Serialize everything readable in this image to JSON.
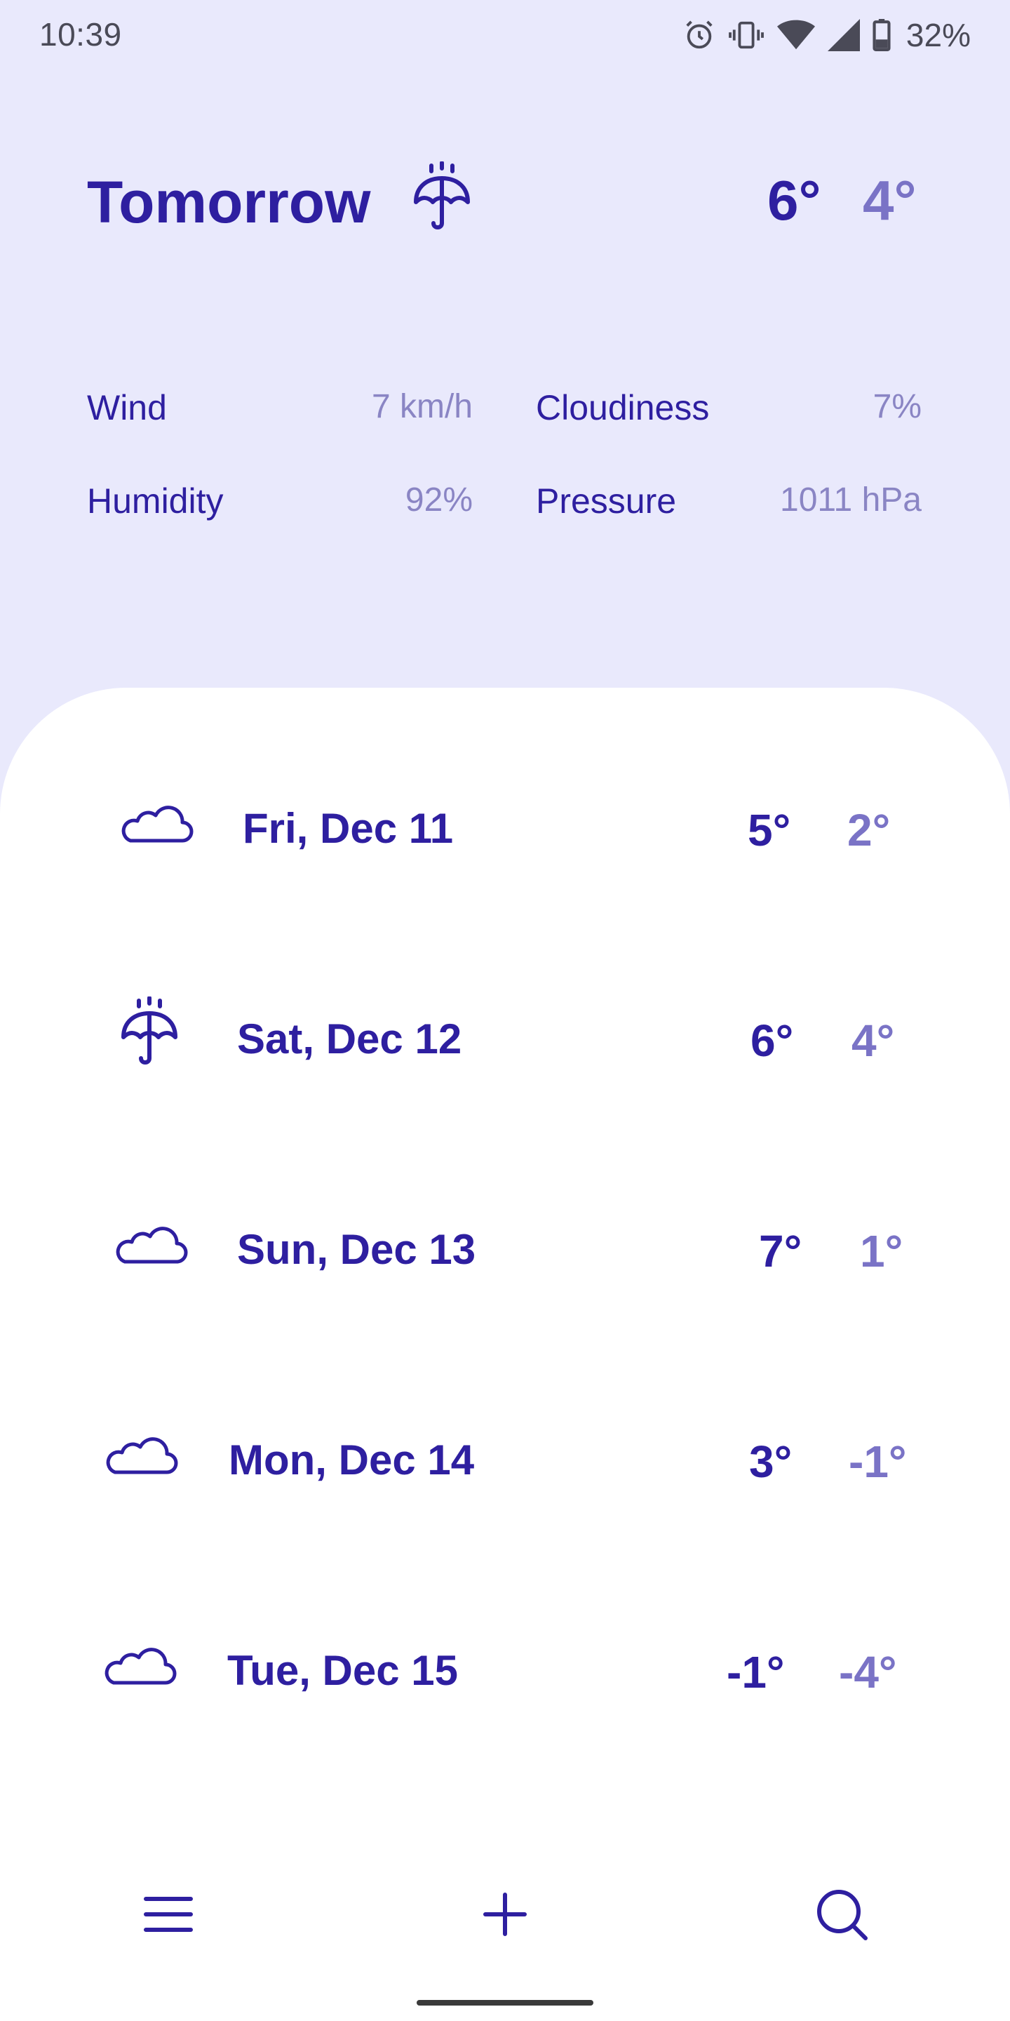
{
  "status_bar": {
    "time": "10:39",
    "battery_percent": "32%",
    "icons": [
      "alarm-icon",
      "vibrate-icon",
      "wifi-icon",
      "signal-icon",
      "battery-icon"
    ]
  },
  "header": {
    "title": "Tomorrow",
    "condition_icon": "umbrella-icon",
    "high": "6°",
    "low": "4°"
  },
  "details": {
    "wind_label": "Wind",
    "wind_value": "7 km/h",
    "cloudiness_label": "Cloudiness",
    "cloudiness_value": "7%",
    "humidity_label": "Humidity",
    "humidity_value": "92%",
    "pressure_label": "Pressure",
    "pressure_value": "1011 hPa"
  },
  "forecast": [
    {
      "icon": "cloud-icon",
      "date": "Fri, Dec 11",
      "high": "5°",
      "low": "2°"
    },
    {
      "icon": "umbrella-icon",
      "date": "Sat, Dec 12",
      "high": "6°",
      "low": "4°"
    },
    {
      "icon": "cloud-icon",
      "date": "Sun, Dec 13",
      "high": "7°",
      "low": "1°"
    },
    {
      "icon": "cloud-icon",
      "date": "Mon, Dec 14",
      "high": "3°",
      "low": "-1°"
    },
    {
      "icon": "cloud-icon",
      "date": "Tue, Dec 15",
      "high": "-1°",
      "low": "-4°"
    }
  ],
  "bottom_nav": {
    "items": [
      "menu-icon",
      "add-icon",
      "search-icon"
    ]
  },
  "colors": {
    "background": "#e9e9fc",
    "primary": "#2e1fa0",
    "secondary": "#7a73c6",
    "card": "#ffffff"
  }
}
